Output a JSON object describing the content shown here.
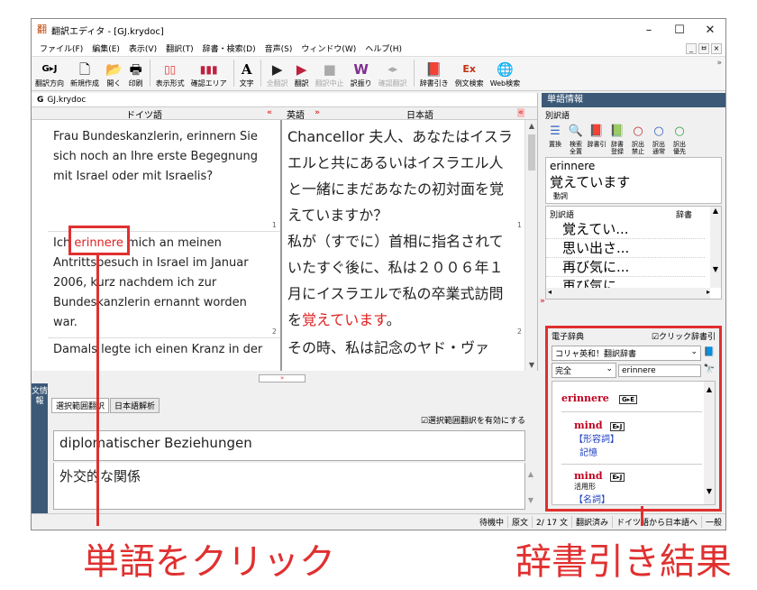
{
  "window": {
    "title": "翻訳エディタ - [GJ.krydoc]",
    "app_icon": "翻"
  },
  "window_controls": {
    "minimize": "–",
    "maximize": "☐",
    "close": "✕"
  },
  "menu": [
    "ファイル(F)",
    "編集(E)",
    "表示(V)",
    "翻訳(T)",
    "辞書・検索(D)",
    "音声(S)",
    "ウィンドウ(W)",
    "ヘルプ(H)"
  ],
  "mdi_controls": [
    "_",
    "ㅂ",
    "×"
  ],
  "toolbar": [
    {
      "icon": "G▸J",
      "label": "翻訳方向"
    },
    {
      "icon": "🗋",
      "label": "新規作成"
    },
    {
      "icon": "📂",
      "label": "開く"
    },
    {
      "icon": "🖶",
      "label": "印刷"
    },
    {
      "icon": "▯▯",
      "label": "表示形式"
    },
    {
      "icon": "▮▮▮",
      "label": "確認エリア"
    },
    {
      "icon": "A",
      "label": "文字"
    },
    {
      "icon": "▶",
      "label": "全翻訳",
      "disabled": true
    },
    {
      "icon": "▶",
      "label": "翻訳"
    },
    {
      "icon": "■",
      "label": "翻訳中止",
      "disabled": true
    },
    {
      "icon": "W",
      "label": "訳振り"
    },
    {
      "icon": "◂▸",
      "label": "確認翻訳",
      "disabled": true
    },
    {
      "icon": "📕",
      "label": "辞書引き"
    },
    {
      "icon": "Ex",
      "label": "例文検索"
    },
    {
      "icon": "🌐",
      "label": "Web検索"
    }
  ],
  "toolbar_more": "»",
  "doc": {
    "tab": "GJ.krydoc",
    "tab_icon": "G",
    "src_header": "ドイツ語",
    "tgt_header": "日本語",
    "swap_left": "«",
    "swap_label": "英語",
    "swap_right": "»",
    "collapse": "«",
    "scroll_up": "▲",
    "scroll_down": "▼",
    "segments": [
      {
        "num": "1",
        "src": "Frau Bundeskanzlerin, erinnern Sie sich noch an Ihre erste Begegnung mit Israel oder mit Israelis?",
        "tgt": "Chancellor 夫人、あなたはイスラエルと共にあるいはイスラエル人と一緒にまだあなたの初対面を覚えていますか？"
      },
      {
        "num": "2",
        "src_pre": "Ich ",
        "src_hl": "erinnere",
        "src_post": " mich an meinen Antrittsbesuch in Israel im Januar 2006, kurz nachdem ich zur Bundeskanzlerin ernannt worden war.",
        "tgt_pre": "私が（すでに）首相に指名されていたすぐ後に、私は２００６年１月にイスラエルで私の卒業式訪問を",
        "tgt_hl": "覚えています",
        "tgt_post": "。"
      },
      {
        "num": "",
        "src": "Damals legte ich einen Kranz in der",
        "tgt": "その時、私は記念のヤド・ヴァ"
      }
    ]
  },
  "splitter_grip": "»",
  "lower": {
    "side_tab": "文情報",
    "tabs": [
      "選択範囲翻訳",
      "日本語解析"
    ],
    "checkbox": "選択範囲翻訳を有効にする",
    "source": "diplomatischer Beziehungen",
    "target": "外交的な関係",
    "scroll_up": "▲",
    "scroll_down": "▼"
  },
  "status": [
    "待機中",
    "原文",
    "2/ 17 文",
    "翻訳済み",
    "ドイツ語から日本語へ",
    "一般"
  ],
  "word_info": {
    "header": "単語情報",
    "section": "別訳語",
    "buttons": [
      {
        "icon": "☰",
        "label": "置換"
      },
      {
        "icon": "🔍",
        "label": "検索\n全置"
      },
      {
        "icon": "📕",
        "label": "辞書引"
      },
      {
        "icon": "📗",
        "label": "辞書\n登録"
      },
      {
        "icon": "○",
        "label": "訳出\n禁止"
      },
      {
        "icon": "○",
        "label": "訳出\n通常"
      },
      {
        "icon": "○",
        "label": "訳出\n優先"
      }
    ],
    "word": "erinnere",
    "translation": "覚えています",
    "pos": "動詞",
    "alt_header_term": "別訳語",
    "alt_header_dict": "辞書",
    "alternatives": [
      "覚えてい...",
      "思い出さ...",
      "再び気に...",
      "再び気に..."
    ],
    "expand": "»",
    "scroll_left": "◂",
    "scroll_right": "▸",
    "scroll_up": "▲",
    "scroll_down": "▼"
  },
  "edict": {
    "title": "電子辞典",
    "click_lookup": "☑クリック辞書引",
    "dictionary": "コリャ英和！翻訳辞書",
    "match": "完全",
    "query": "erinnere",
    "dropdown": "⌄",
    "book_icon": "📘",
    "search_icon": "🔭",
    "entry": "erinnere",
    "entry_badge": "G▸E",
    "results": [
      {
        "word": "mind",
        "badge": "E▸J",
        "kind": "",
        "pos": "【形容詞】",
        "meaning": "記憶"
      },
      {
        "word": "mind",
        "badge": "E▸J",
        "kind": "活用形",
        "pos": "【名詞】",
        "meaning": ""
      }
    ],
    "scroll_up": "▲",
    "scroll_down": "▼"
  },
  "annotations": {
    "left": "単語をクリック",
    "right": "辞書引き結果"
  },
  "colors": {
    "accent_red": "#e03030",
    "panel_header": "#3c5a78"
  }
}
